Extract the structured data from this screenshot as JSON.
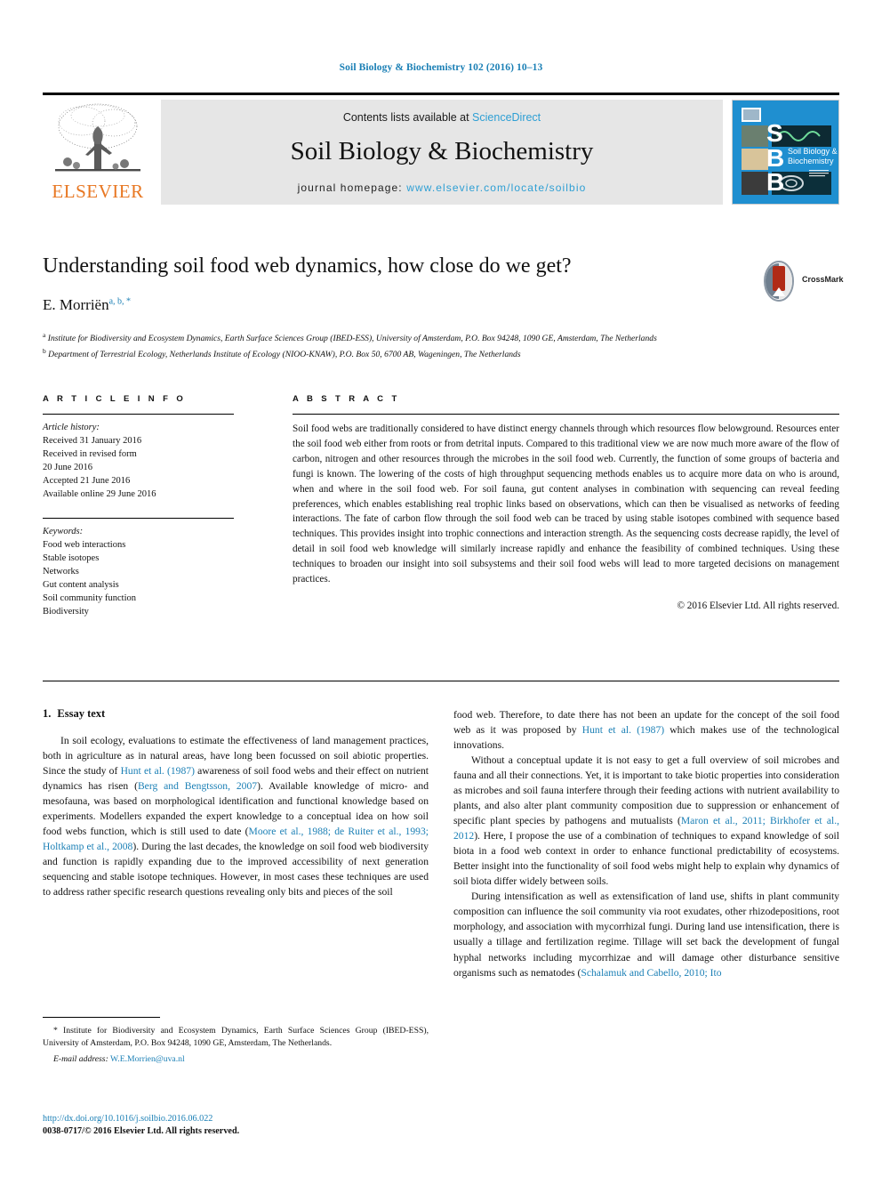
{
  "running_head": "Soil Biology & Biochemistry 102 (2016) 10–13",
  "masthead": {
    "contents_prefix": "Contents lists available at ",
    "sciencedirect": "ScienceDirect",
    "journal_title": "Soil Biology & Biochemistry",
    "homepage_prefix": "journal homepage: ",
    "homepage_url": "www.elsevier.com/locate/soilbio",
    "publisher": "ELSEVIER",
    "cover_lines": [
      "S",
      "B",
      "B"
    ],
    "cover_title": "Soil Biology & Biochemistry",
    "accent_blue": "#2e9fd4",
    "elsevier_orange": "#e87722"
  },
  "article": {
    "title": "Understanding soil food web dynamics, how close do we get?",
    "author": "E. Morriën",
    "author_marks": "a, b, *",
    "affiliation_a_mark": "a",
    "affiliation_a": "Institute for Biodiversity and Ecosystem Dynamics, Earth Surface Sciences Group (IBED-ESS), University of Amsterdam, P.O. Box 94248, 1090 GE, Amsterdam, The Netherlands",
    "affiliation_b_mark": "b",
    "affiliation_b": "Department of Terrestrial Ecology, Netherlands Institute of Ecology (NIOO-KNAW), P.O. Box 50, 6700 AB, Wageningen, The Netherlands",
    "crossmark_label": "CrossMark"
  },
  "article_info": {
    "heading": "A R T I C L E  I N F O",
    "history_label": "Article history:",
    "history_lines": [
      "Received 31 January 2016",
      "Received in revised form",
      "20 June 2016",
      "Accepted 21 June 2016",
      "Available online 29 June 2016"
    ],
    "keywords_label": "Keywords:",
    "keywords": [
      "Food web interactions",
      "Stable isotopes",
      "Networks",
      "Gut content analysis",
      "Soil community function",
      "Biodiversity"
    ]
  },
  "abstract": {
    "heading": "A B S T R A C T",
    "text": "Soil food webs are traditionally considered to have distinct energy channels through which resources flow belowground. Resources enter the soil food web either from roots or from detrital inputs. Compared to this traditional view we are now much more aware of the flow of carbon, nitrogen and other resources through the microbes in the soil food web. Currently, the function of some groups of bacteria and fungi is known. The lowering of the costs of high throughput sequencing methods enables us to acquire more data on who is around, when and where in the soil food web. For soil fauna, gut content analyses in combination with sequencing can reveal feeding preferences, which enables establishing real trophic links based on observations, which can then be visualised as networks of feeding interactions. The fate of carbon flow through the soil food web can be traced by using stable isotopes combined with sequence based techniques. This provides insight into trophic connections and interaction strength. As the sequencing costs decrease rapidly, the level of detail in soil food web knowledge will similarly increase rapidly and enhance the feasibility of combined techniques. Using these techniques to broaden our insight into soil subsystems and their soil food webs will lead to more targeted decisions on management practices.",
    "copyright": "© 2016 Elsevier Ltd. All rights reserved."
  },
  "body": {
    "section_number": "1.",
    "section_title": "Essay text",
    "left_paragraphs": [
      {
        "segments": [
          {
            "t": "In soil ecology, evaluations to estimate the effectiveness of land management practices, both in agriculture as in natural areas, have long been focussed on soil abiotic properties. Since the study of ",
            "ref": false
          },
          {
            "t": "Hunt et al. (1987)",
            "ref": true
          },
          {
            "t": " awareness of soil food webs and their effect on nutrient dynamics has risen (",
            "ref": false
          },
          {
            "t": "Berg and Bengtsson, 2007",
            "ref": true
          },
          {
            "t": "). Available knowledge of micro- and mesofauna, was based on morphological identification and functional knowledge based on experiments. Modellers expanded the expert knowledge to a conceptual idea on how soil food webs function, which is still used to date (",
            "ref": false
          },
          {
            "t": "Moore et al., 1988; de Ruiter et al., 1993; Holtkamp et al., 2008",
            "ref": true
          },
          {
            "t": "). During the last decades, the knowledge on soil food web biodiversity and function is rapidly expanding due to the improved accessibility of next generation sequencing and stable isotope techniques. However, in most cases these techniques are used to address rather specific research questions revealing only bits and pieces of the soil",
            "ref": false
          }
        ]
      }
    ],
    "right_paragraphs": [
      {
        "indent": false,
        "segments": [
          {
            "t": "food web. Therefore, to date there has not been an update for the concept of the soil food web as it was proposed by ",
            "ref": false
          },
          {
            "t": "Hunt et al. (1987)",
            "ref": true
          },
          {
            "t": " which makes use of the technological innovations.",
            "ref": false
          }
        ]
      },
      {
        "indent": true,
        "segments": [
          {
            "t": "Without a conceptual update it is not easy to get a full overview of soil microbes and fauna and all their connections. Yet, it is important to take biotic properties into consideration as microbes and soil fauna interfere through their feeding actions with nutrient availability to plants, and also alter plant community composition due to suppression or enhancement of specific plant species by pathogens and mutualists (",
            "ref": false
          },
          {
            "t": "Maron et al., 2011; Birkhofer et al., 2012",
            "ref": true
          },
          {
            "t": "). Here, I propose the use of a combination of techniques to expand knowledge of soil biota in a food web context in order to enhance functional predictability of ecosystems. Better insight into the functionality of soil food webs might help to explain why dynamics of soil biota differ widely between soils.",
            "ref": false
          }
        ]
      },
      {
        "indent": true,
        "segments": [
          {
            "t": "During intensification as well as extensification of land use, shifts in plant community composition can influence the soil community via root exudates, other rhizodepositions, root morphology, and association with mycorrhizal fungi. During land use intensification, there is usually a tillage and fertilization regime. Tillage will set back the development of fungal hyphal networks including mycorrhizae and will damage other disturbance sensitive organisms such as nematodes (",
            "ref": false
          },
          {
            "t": "Schalamuk and Cabello, 2010; Ito",
            "ref": true
          }
        ]
      }
    ]
  },
  "footnote": {
    "marker": "*",
    "text": "Institute for Biodiversity and Ecosystem Dynamics, Earth Surface Sciences Group (IBED-ESS), University of Amsterdam, P.O. Box 94248, 1090 GE, Amsterdam, The Netherlands.",
    "email_label": "E-mail address:",
    "email": "W.E.Morrien@uva.nl"
  },
  "imprint": {
    "doi": "http://dx.doi.org/10.1016/j.soilbio.2016.06.022",
    "issn_line": "0038-0717/© 2016 Elsevier Ltd. All rights reserved."
  }
}
